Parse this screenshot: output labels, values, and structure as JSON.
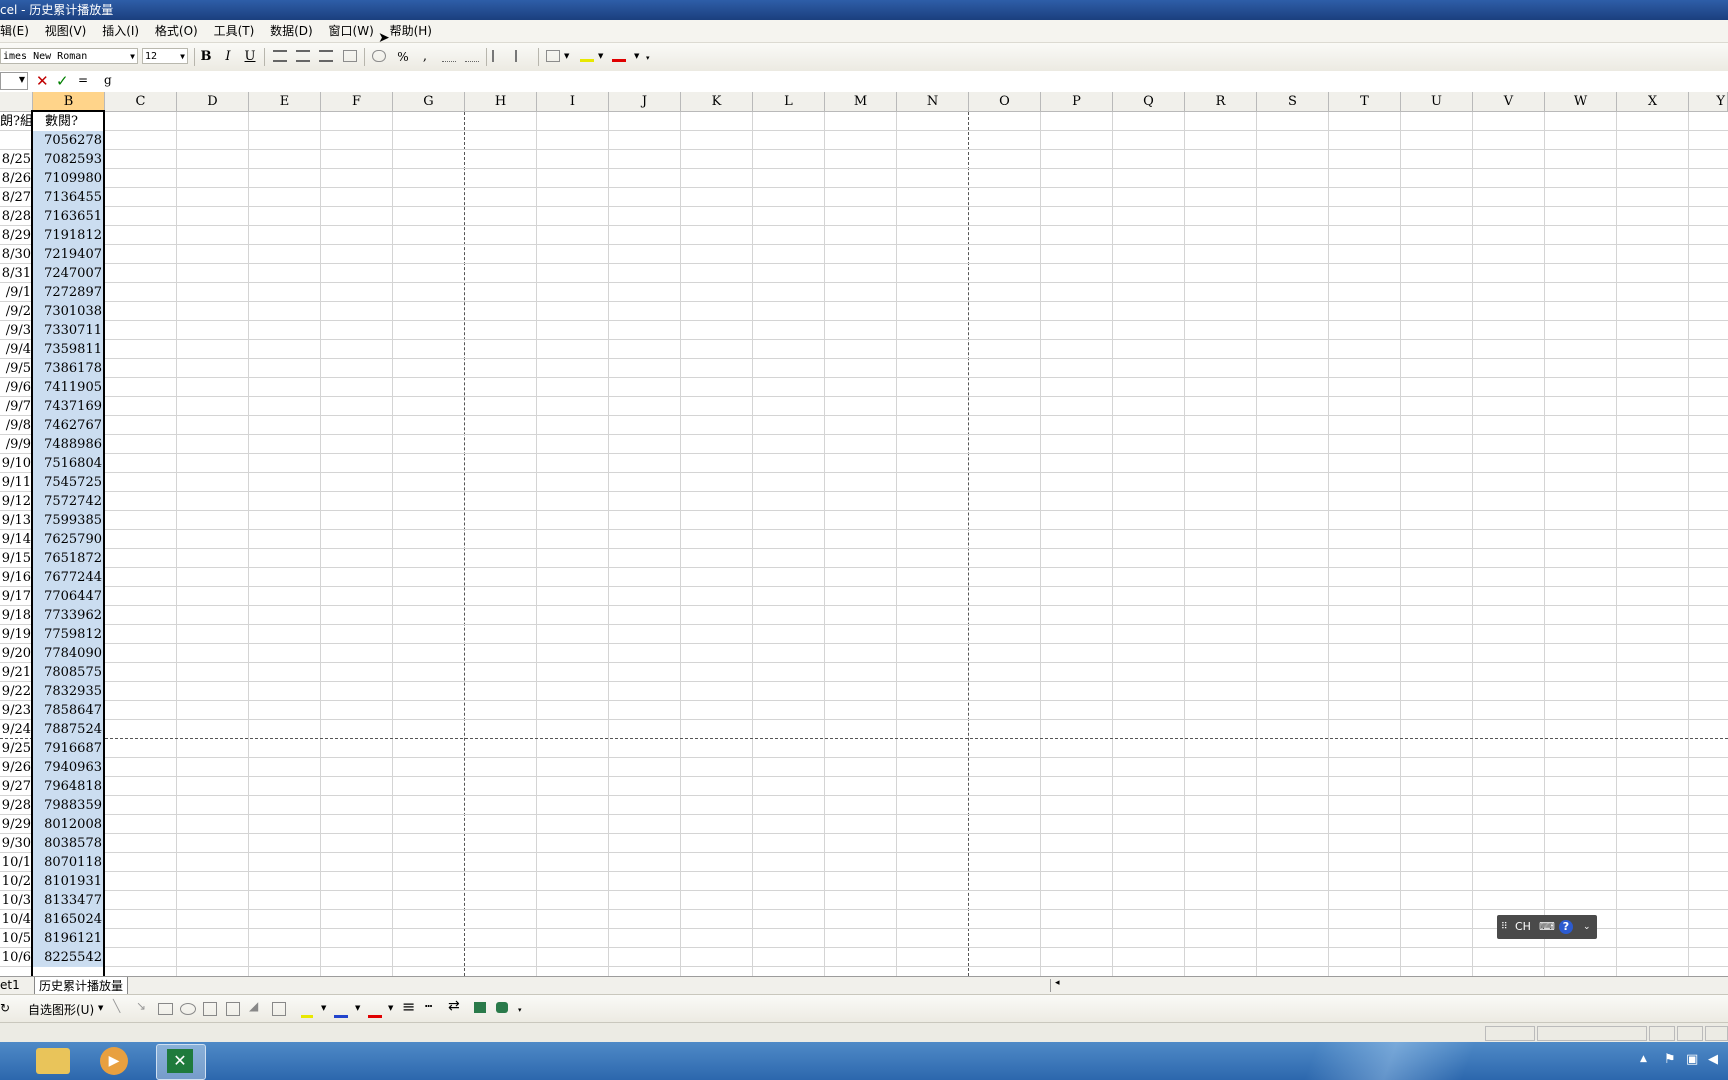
{
  "titlebar": {
    "title": "cel - 历史累计播放量"
  },
  "menu": [
    "辑(E)",
    "视图(V)",
    "插入(I)",
    "格式(O)",
    "工具(T)",
    "数据(D)",
    "窗口(W)",
    "帮助(H)"
  ],
  "toolbar": {
    "font_name": "imes New Roman",
    "font_size": "12",
    "bold": "B",
    "italic": "I",
    "underline": "U",
    "percent": "%",
    "comma": ","
  },
  "formula": {
    "content": "g",
    "equals": "="
  },
  "columns": [
    "B",
    "C",
    "D",
    "E",
    "F",
    "G",
    "H",
    "I",
    "J",
    "K",
    "L",
    "M",
    "N",
    "O",
    "P",
    "Q",
    "R",
    "S",
    "T",
    "U",
    "V",
    "W",
    "X",
    "Y"
  ],
  "grid": {
    "header_a": "朗?組",
    "header_b": "數閱?",
    "rows": [
      {
        "a": "",
        "b": "7056278"
      },
      {
        "a": "8/25",
        "b": "7082593"
      },
      {
        "a": "8/26",
        "b": "7109980"
      },
      {
        "a": "8/27",
        "b": "7136455"
      },
      {
        "a": "8/28",
        "b": "7163651"
      },
      {
        "a": "8/29",
        "b": "7191812"
      },
      {
        "a": "8/30",
        "b": "7219407"
      },
      {
        "a": "8/31",
        "b": "7247007"
      },
      {
        "a": "/9/1",
        "b": "7272897"
      },
      {
        "a": "/9/2",
        "b": "7301038"
      },
      {
        "a": "/9/3",
        "b": "7330711"
      },
      {
        "a": "/9/4",
        "b": "7359811"
      },
      {
        "a": "/9/5",
        "b": "7386178"
      },
      {
        "a": "/9/6",
        "b": "7411905"
      },
      {
        "a": "/9/7",
        "b": "7437169"
      },
      {
        "a": "/9/8",
        "b": "7462767"
      },
      {
        "a": "/9/9",
        "b": "7488986"
      },
      {
        "a": "9/10",
        "b": "7516804"
      },
      {
        "a": "9/11",
        "b": "7545725"
      },
      {
        "a": "9/12",
        "b": "7572742"
      },
      {
        "a": "9/13",
        "b": "7599385"
      },
      {
        "a": "9/14",
        "b": "7625790"
      },
      {
        "a": "9/15",
        "b": "7651872"
      },
      {
        "a": "9/16",
        "b": "7677244"
      },
      {
        "a": "9/17",
        "b": "7706447"
      },
      {
        "a": "9/18",
        "b": "7733962"
      },
      {
        "a": "9/19",
        "b": "7759812"
      },
      {
        "a": "9/20",
        "b": "7784090"
      },
      {
        "a": "9/21",
        "b": "7808575"
      },
      {
        "a": "9/22",
        "b": "7832935"
      },
      {
        "a": "9/23",
        "b": "7858647"
      },
      {
        "a": "9/24",
        "b": "7887524"
      },
      {
        "a": "9/25",
        "b": "7916687"
      },
      {
        "a": "9/26",
        "b": "7940963"
      },
      {
        "a": "9/27",
        "b": "7964818"
      },
      {
        "a": "9/28",
        "b": "7988359"
      },
      {
        "a": "9/29",
        "b": "8012008"
      },
      {
        "a": "9/30",
        "b": "8038578"
      },
      {
        "a": "10/1",
        "b": "8070118"
      },
      {
        "a": "10/2",
        "b": "8101931"
      },
      {
        "a": "10/3",
        "b": "8133477"
      },
      {
        "a": "10/4",
        "b": "8165024"
      },
      {
        "a": "10/5",
        "b": "8196121"
      },
      {
        "a": "10/6",
        "b": "8225542"
      }
    ]
  },
  "sheet_tabs": [
    "et1",
    "历史累计播放量"
  ],
  "drawing": {
    "autoshapes": "自选图形(U)"
  },
  "langbar": {
    "lang": "CH",
    "help": "?"
  },
  "colors": {
    "selection": "#cbddf0",
    "grid": "#d4d4d4",
    "taskbar": "#2c67ad"
  }
}
